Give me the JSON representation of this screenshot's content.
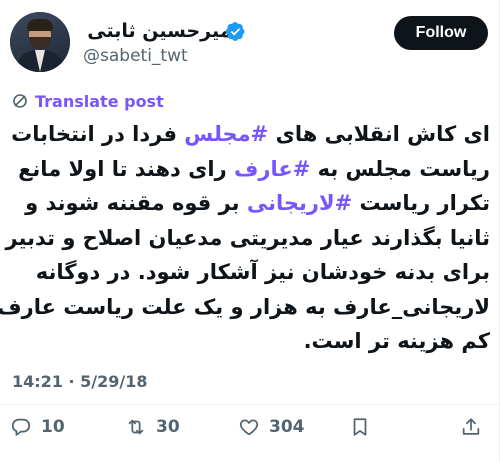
{
  "author": {
    "display_name": "امیرحسین ثابتی",
    "handle": "@sabeti_twt",
    "verified": true
  },
  "follow_label": "Follow",
  "translate_label": "Translate post",
  "tweet": {
    "lines": [
      [
        {
          "t": "ای کاش انقلابی های "
        },
        {
          "t": "#مجلس",
          "tag": true
        },
        {
          "t": " فردا در انتخابات"
        }
      ],
      [
        {
          "t": "ریاست مجلس به "
        },
        {
          "t": "#عارف",
          "tag": true
        },
        {
          "t": " رای دهند تا اولا مانع"
        }
      ],
      [
        {
          "t": "تکرار ریاست "
        },
        {
          "t": "#لاریجانی",
          "tag": true
        },
        {
          "t": " بر قوه مقننه شوند و"
        }
      ],
      [
        {
          "t": "ثانیا بگذارند عیار مدیریتی مدعیان اصلاح و تدبیر"
        }
      ],
      [
        {
          "t": "برای بدنه خودشان نیز آشکار شود. در دوگانه"
        }
      ],
      [
        {
          "t": "لاریجانی_عارف به هزار و یک علت ریاست عارف"
        }
      ],
      [
        {
          "t": "کم هزینه تر است."
        }
      ]
    ]
  },
  "timestamp": "14:21 · 5/29/18",
  "stats": {
    "replies": "10",
    "retweets": "30",
    "likes": "304"
  },
  "colors": {
    "accent": "#7856ff",
    "text": "#0f1419",
    "muted": "#536471",
    "verified": "#1d9bf0"
  }
}
